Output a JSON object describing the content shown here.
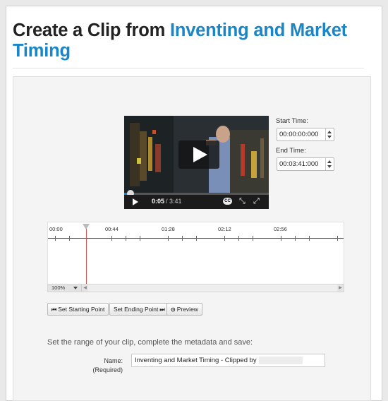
{
  "header": {
    "title_prefix": "Create a Clip from ",
    "title_highlight": "Inventing and Market Timing"
  },
  "player": {
    "current_time": "0:05",
    "total_time": "/ 3:41",
    "cc_label": "CC",
    "progress": 0.023
  },
  "fields": {
    "start_time_label": "Start Time:",
    "start_time_value": "00:00:00:000",
    "end_time_label": "End Time:",
    "end_time_value": "00:03:41:000"
  },
  "timeline": {
    "ticks": [
      "00:00",
      "00:44",
      "01:28",
      "02:12",
      "02:56"
    ],
    "zoom": "100%"
  },
  "buttons": {
    "set_start": "Set Starting Point",
    "set_end": "Set Ending Point",
    "preview": "Preview"
  },
  "form": {
    "instructions": "Set the range of your clip, complete the metadata and save:",
    "name_label": "Name:",
    "required_label": "(Required)",
    "name_value": "Inventing and Market Timing - Clipped by"
  },
  "colors": {
    "accent": "#1a86c8",
    "playhead": "#d9534f"
  }
}
